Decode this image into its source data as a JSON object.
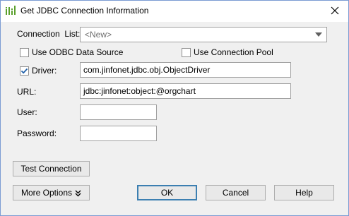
{
  "window": {
    "title": "Get JDBC Connection Information",
    "close_glyph": "✕"
  },
  "connection_list": {
    "label": "Connection  List:",
    "selected": "<New>"
  },
  "options": {
    "use_odbc_label": "Use ODBC Data Source",
    "use_odbc_checked": false,
    "use_pool_label": "Use Connection Pool",
    "use_pool_checked": false
  },
  "driver": {
    "label": "Driver:",
    "checked": true,
    "value": "com.jinfonet.jdbc.obj.ObjectDriver"
  },
  "url": {
    "label": "URL:",
    "value": "jdbc:jinfonet:object:@orgchart"
  },
  "user": {
    "label": "User:",
    "value": ""
  },
  "password": {
    "label": "Password:",
    "value": ""
  },
  "buttons": {
    "test_connection": "Test Connection",
    "more_options": "More Options",
    "ok": "OK",
    "cancel": "Cancel",
    "help": "Help"
  },
  "icons": {
    "app": "bar-chart-icon",
    "close": "close-icon",
    "dropdown": "chevron-down-icon",
    "check": "check-icon",
    "expand": "double-chevron-down-icon"
  },
  "colors": {
    "app_icon_green": "#5aa02c",
    "check_blue": "#1e5fa8",
    "default_button_border": "#3c7fb1"
  }
}
